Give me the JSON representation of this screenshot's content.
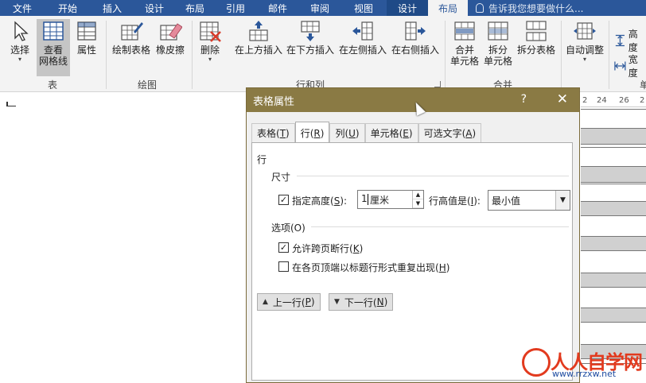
{
  "ribbon_tabs": [
    {
      "label": "文件",
      "w": 56
    },
    {
      "label": "开始",
      "w": 58
    },
    {
      "label": "插入",
      "w": 54
    },
    {
      "label": "设计",
      "w": 52
    },
    {
      "label": "布局",
      "w": 50
    },
    {
      "label": "引用",
      "w": 52
    },
    {
      "label": "邮件",
      "w": 54
    },
    {
      "label": "审阅",
      "w": 52
    },
    {
      "label": "视图",
      "w": 58
    },
    {
      "label": "设计",
      "w": 52
    },
    {
      "label": "布局",
      "w": 50
    }
  ],
  "tell_me": "告诉我您想要做什么...",
  "ribbon": {
    "select": "选择",
    "view_grid": "查看",
    "view_grid2": "网格线",
    "properties": "属性",
    "draw_table": "绘制表格",
    "eraser": "橡皮擦",
    "delete": "删除",
    "insert_above": "在上方插入",
    "insert_below": "在下方插入",
    "insert_left": "在左侧插入",
    "insert_right": "在右侧插入",
    "merge1": "合并",
    "merge2": "单元格",
    "split1": "拆分",
    "split2": "单元格",
    "split_table": "拆分表格",
    "autofit": "自动调整",
    "height": "高度",
    "width": "宽度",
    "group_table": "表",
    "group_draw": "绘图",
    "group_rowcol": "行和列",
    "group_merge": "合并",
    "group_size": "单"
  },
  "ruler_ticks": [
    "2",
    "24",
    "26",
    "2"
  ],
  "dialog": {
    "title": "表格属性",
    "help": "?",
    "close": "✕",
    "tabs": [
      {
        "label": "表格(",
        "key": "T",
        "end": ")"
      },
      {
        "label": "行(",
        "key": "R",
        "end": ")"
      },
      {
        "label": "列(",
        "key": "U",
        "end": ")"
      },
      {
        "label": "单元格(",
        "key": "E",
        "end": ")"
      },
      {
        "label": "可选文字(",
        "key": "A",
        "end": ")"
      }
    ],
    "section_row": "行",
    "size_label": "尺寸",
    "specify_height": "指定高度(",
    "specify_height_key": "S",
    "height_value": "1",
    "height_unit": "厘米",
    "row_height_is": "行高值是(",
    "row_height_is_key": "I",
    "row_height_mode": "最小值",
    "options_label": "选项(O)",
    "allow_break": "允许跨页断行(",
    "allow_break_key": "K",
    "repeat_header": "在各页顶端以标题行形式重复出现(",
    "repeat_header_key": "H",
    "prev_row": "上一行(",
    "prev_row_key": "P",
    "next_row": "下一行(",
    "next_row_key": "N",
    "checks": {
      "specify_height": true,
      "allow_break": true,
      "repeat_header": false
    }
  },
  "watermark": {
    "brand": "人人自学网",
    "url": "www.rrzxw.net"
  }
}
